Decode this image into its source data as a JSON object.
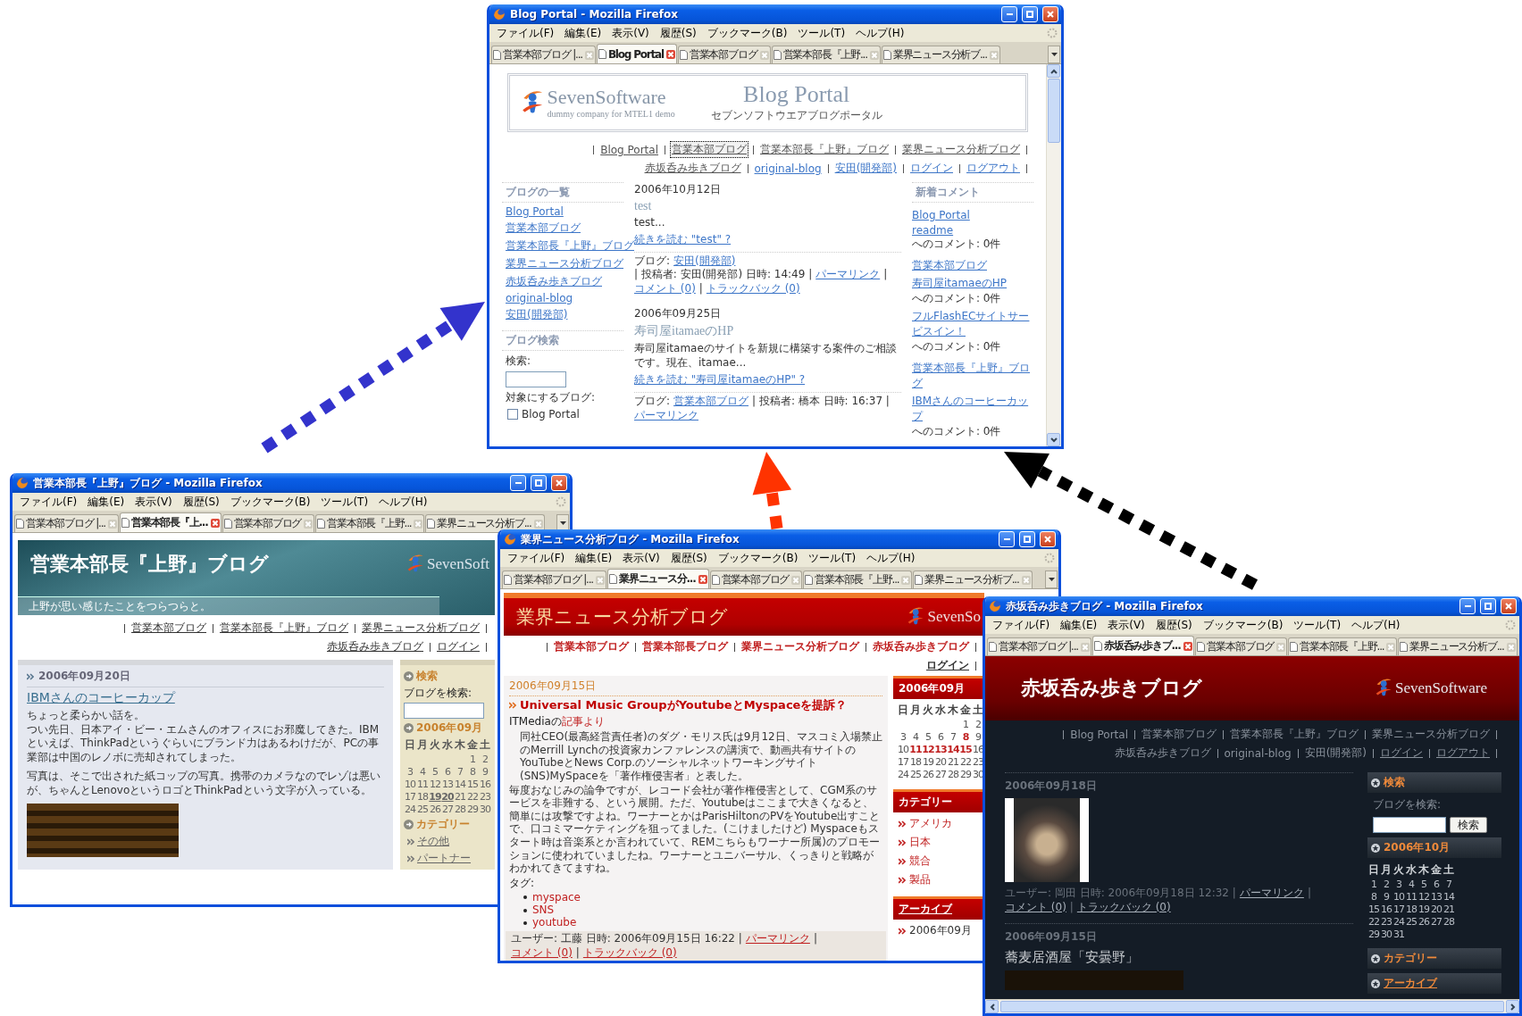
{
  "windows": [
    {
      "kind": "portal",
      "title": "Blog Portal - Mozilla Firefox",
      "menu": [
        "ファイル(F)",
        "編集(E)",
        "表示(V)",
        "履歴(S)",
        "ブックマーク(B)",
        "ツール(T)",
        "ヘルプ(H)"
      ],
      "tabs": [
        {
          "label": "営業本部ブログ |...",
          "selected": false
        },
        {
          "label": "Blog Portal",
          "selected": true
        },
        {
          "label": "営業本部ブログ",
          "selected": false
        },
        {
          "label": "営業本部長『上野...",
          "selected": false
        },
        {
          "label": "業界ニュース分析ブ...",
          "selected": false
        }
      ],
      "page": {
        "logo": {
          "name": "SevenSoftware",
          "tagline": "dummy company for MTEL1 demo"
        },
        "title": "Blog Portal",
        "subtitle": "セブンソフトウエアブログポータル",
        "nav": [
          {
            "label": "Blog Portal",
            "selected": false
          },
          {
            "label": "営業本部ブログ",
            "selected": true
          },
          {
            "label": "営業本部長『上野』ブログ",
            "selected": false
          },
          {
            "label": "業界ニュース分析ブログ",
            "selected": false
          },
          {
            "label": "赤坂呑み歩きブログ",
            "selected": false
          },
          {
            "label": "original-blog",
            "selected": false
          },
          {
            "label": "安田(開発部)",
            "selected": false
          },
          {
            "label": "ログイン",
            "selected": false
          },
          {
            "label": "ログアウト",
            "selected": false
          }
        ],
        "blog_list": {
          "heading": "ブログの一覧",
          "items": [
            "Blog Portal",
            "営業本部ブログ",
            "営業本部長『上野』ブログ",
            "業界ニュース分析ブログ",
            "赤坂呑み歩きブログ",
            "original-blog",
            "安田(開発部)"
          ]
        },
        "search": {
          "heading": "ブログ検索",
          "label": "検索:",
          "targets_label": "対象にするブログ:",
          "targets": [
            {
              "label": "Blog Portal",
              "checked": false
            }
          ]
        },
        "posts": [
          {
            "date": "2006年10月12日",
            "title": "test",
            "excerpt": "test...",
            "more": "続きを読む \"test\" ?",
            "meta": [
              {
                "text": "ブログ: ",
                "link": false
              },
              {
                "text": "安田(開発部)",
                "link": true
              },
              {
                "text": " | 投稿者: 安田(開発部) 日時: 14:49 | ",
                "link": false
              },
              {
                "text": "パーマリンク",
                "link": true
              },
              {
                "text": " | ",
                "link": false
              },
              {
                "text": "コメント (0)",
                "link": true
              },
              {
                "text": " | ",
                "link": false
              },
              {
                "text": "トラックバック (0)",
                "link": true
              }
            ]
          },
          {
            "date": "2006年09月25日",
            "title": "寿司屋itamaeのHP",
            "excerpt": "寿司屋itamaeのサイトを新規に構築する案件のご相談です。現在、itamae...",
            "more": "続きを読む \"寿司屋itamaeのHP\" ?",
            "meta": [
              {
                "text": "ブログ: ",
                "link": false
              },
              {
                "text": "営業本部ブログ",
                "link": true
              },
              {
                "text": " | 投稿者: 橋本 日時: 16:37 | ",
                "link": false
              },
              {
                "text": "パーマリンク",
                "link": true
              }
            ]
          }
        ],
        "recent": {
          "heading": "新着コメント",
          "items": [
            {
              "kind": "blog",
              "link": "Blog Portal"
            },
            {
              "kind": "comment",
              "link": "readme",
              "suffix": "へのコメント: 0件"
            },
            {
              "kind": "blog",
              "link": "営業本部ブログ"
            },
            {
              "kind": "comment",
              "link": "寿司屋itamaeのHP",
              "suffix": "へのコメント: 0件"
            },
            {
              "kind": "comment",
              "link": "フルFlashECサイトサービスイン！",
              "suffix": "へのコメント: 0件"
            },
            {
              "kind": "blog",
              "link": "営業本部長『上野』ブログ"
            },
            {
              "kind": "comment",
              "link": "IBMさんのコーヒーカップ",
              "suffix": "へのコメント: 0件"
            }
          ]
        }
      }
    },
    {
      "kind": "teal",
      "title": "営業本部長『上野』ブログ - Mozilla Firefox",
      "menu": [
        "ファイル(F)",
        "編集(E)",
        "表示(V)",
        "履歴(S)",
        "ブックマーク(B)",
        "ツール(T)",
        "ヘルプ(H)"
      ],
      "tabs": [
        {
          "label": "営業本部ブログ |...",
          "selected": false
        },
        {
          "label": "営業本部長『上...",
          "selected": true
        },
        {
          "label": "営業本部ブログ",
          "selected": false
        },
        {
          "label": "営業本部長『上野...",
          "selected": false
        },
        {
          "label": "業界ニュース分析ブ...",
          "selected": false
        }
      ],
      "page": {
        "title": "営業本部長『上野』ブログ",
        "logo": {
          "name": "SevenSoft"
        },
        "tagline": "上野が思い感じたことをつらつらと。",
        "nav": [
          "営業本部ブログ",
          "営業本部長『上野』ブログ",
          "業界ニュース分析ブログ",
          "赤坂呑み歩きブログ",
          "ログイン"
        ],
        "post": {
          "date": "2006年09月20日",
          "title": "IBMさんのコーヒーカップ",
          "paragraphs": [
            [
              "ちょっと柔らかい話を。",
              "つい先日、日本アイ・ビー・エムさんのオフィスにお邪魔してきた。IBMといえば、ThinkPadというぐらいにブランド力はあるわけだが、PCの事業部は中国のレノボに売却されてしまった。"
            ],
            [
              "写真は、そこで出された紙コップの写真。携帯のカメラなのでレゾは悪いが、ちゃんとLenovoというロゴとThinkPadという文字が入っている。"
            ]
          ]
        },
        "sidebar": {
          "search_heading": "検索",
          "search_label": "ブログを検索:",
          "calendar": {
            "heading": "2006年09月",
            "weekdays": [
              "日",
              "月",
              "火",
              "水",
              "木",
              "金",
              "土"
            ],
            "weeks": [
              {
                "kind": "end_aligned",
                "days": [
                  {
                    "day": "1",
                    "linked": false
                  },
                  {
                    "day": "2",
                    "linked": false
                  }
                ]
              },
              {
                "kind": "start_aligned",
                "days": [
                  {
                    "day": "3",
                    "linked": false
                  },
                  {
                    "day": "4",
                    "linked": false
                  },
                  {
                    "day": "5",
                    "linked": false
                  },
                  {
                    "day": "6",
                    "linked": false
                  },
                  {
                    "day": "7",
                    "linked": false
                  },
                  {
                    "day": "8",
                    "linked": false
                  },
                  {
                    "day": "9",
                    "linked": false
                  }
                ]
              },
              {
                "kind": "start_aligned",
                "days": [
                  {
                    "day": "10",
                    "linked": false
                  },
                  {
                    "day": "11",
                    "linked": false
                  },
                  {
                    "day": "12",
                    "linked": false
                  },
                  {
                    "day": "13",
                    "linked": false
                  },
                  {
                    "day": "14",
                    "linked": false
                  },
                  {
                    "day": "15",
                    "linked": false
                  },
                  {
                    "day": "16",
                    "linked": false
                  }
                ]
              },
              {
                "kind": "start_aligned",
                "days": [
                  {
                    "day": "17",
                    "linked": false
                  },
                  {
                    "day": "18",
                    "linked": false
                  },
                  {
                    "day": "19",
                    "linked": true
                  },
                  {
                    "day": "20",
                    "linked": true
                  },
                  {
                    "day": "21",
                    "linked": false
                  },
                  {
                    "day": "22",
                    "linked": false
                  },
                  {
                    "day": "23",
                    "linked": false
                  }
                ]
              },
              {
                "kind": "start_aligned",
                "days": [
                  {
                    "day": "24",
                    "linked": false
                  },
                  {
                    "day": "25",
                    "linked": false
                  },
                  {
                    "day": "26",
                    "linked": false
                  },
                  {
                    "day": "27",
                    "linked": false
                  },
                  {
                    "day": "28",
                    "linked": false
                  },
                  {
                    "day": "29",
                    "linked": false
                  },
                  {
                    "day": "30",
                    "linked": false
                  }
                ]
              }
            ]
          },
          "category_heading": "カテゴリー",
          "categories": [
            "その他",
            "パートナー"
          ]
        }
      }
    },
    {
      "kind": "red",
      "title": "業界ニュース分析ブログ - Mozilla Firefox",
      "menu": [
        "ファイル(F)",
        "編集(E)",
        "表示(V)",
        "履歴(S)",
        "ブックマーク(B)",
        "ツール(T)",
        "ヘルプ(H)"
      ],
      "tabs": [
        {
          "label": "営業本部ブログ |...",
          "selected": false
        },
        {
          "label": "業界ニュース分...",
          "selected": true
        },
        {
          "label": "営業本部ブログ",
          "selected": false
        },
        {
          "label": "営業本部長『上野...",
          "selected": false
        },
        {
          "label": "業界ニュース分析ブ...",
          "selected": false
        }
      ],
      "page": {
        "title": "業界ニュース分析ブログ",
        "logo": {
          "name": "SevenSo"
        },
        "nav": [
          "営業本部ブログ",
          "営業本部長ブログ",
          "業界ニュース分析ブログ",
          "赤坂呑み歩きブログ",
          "ログイン"
        ],
        "post": {
          "date": "2006年09月15日",
          "title": "Universal Music GroupがYoutubeとMyspaceを提訴？",
          "source_text": "ITMediaの",
          "source_link": "記事より",
          "quote": "同社CEO(最高経営責任者)のダグ・モリス氏は9月12日、マスコミ入場禁止のMerrill Lynchの投資家カンファレンスの講演で、動画共有サイトのYouTubeとNews Corp.のソーシャルネットワーキングサイト(SNS)MySpaceを「著作権侵害者」と表した。",
          "body": "毎度おなじみの論争ですが、レコード会社が著作権侵害として、CGM系のサービスを非難する、という展開。ただ、Youtubeはここまで大きくなると、簡単には攻撃ですよね。ワーナーとかはParisHiltonのPVをYoutube出すことで、口コミマーケティングを狙ってました。(こけましたけど) Myspaceもスタート時は音楽系とか言われていて、REMこちらもワーナー所属)のプロモーションに使われていましたね。ワーナーとユニバーサル、くっきりと戦略がわかれてきてますね。",
          "tags_label": "タグ:",
          "tags": [
            "myspace",
            "SNS",
            "youtube"
          ],
          "meta": [
            {
              "text": "ユーザー: 工藤 日時: 2006年09月15日 16:22 | ",
              "link": false
            },
            {
              "text": "パーマリンク",
              "link": true
            },
            {
              "text": " | ",
              "link": false
            },
            {
              "text": "コメント (0)",
              "link": true
            },
            {
              "text": " | ",
              "link": false
            },
            {
              "text": "トラックバック (0)",
              "link": true
            }
          ]
        },
        "sidebar": {
          "calendar": {
            "heading": "2006年09月",
            "weekdays": [
              "日",
              "月",
              "火",
              "水",
              "木",
              "金",
              "土"
            ],
            "weeks": [
              {
                "kind": "end_aligned",
                "days": [
                  {
                    "day": "1",
                    "linked": false
                  },
                  {
                    "day": "2",
                    "linked": false
                  }
                ]
              },
              {
                "kind": "start_aligned",
                "days": [
                  {
                    "day": "3",
                    "linked": false
                  },
                  {
                    "day": "4",
                    "linked": false
                  },
                  {
                    "day": "5",
                    "linked": false
                  },
                  {
                    "day": "6",
                    "linked": false
                  },
                  {
                    "day": "7",
                    "linked": false
                  },
                  {
                    "day": "8",
                    "linked": true
                  },
                  {
                    "day": "9",
                    "linked": false
                  }
                ]
              },
              {
                "kind": "start_aligned",
                "days": [
                  {
                    "day": "10",
                    "linked": false
                  },
                  {
                    "day": "11",
                    "linked": true
                  },
                  {
                    "day": "12",
                    "linked": true
                  },
                  {
                    "day": "13",
                    "linked": true
                  },
                  {
                    "day": "14",
                    "linked": true
                  },
                  {
                    "day": "15",
                    "linked": true
                  },
                  {
                    "day": "16",
                    "linked": false
                  }
                ]
              },
              {
                "kind": "start_aligned",
                "days": [
                  {
                    "day": "17",
                    "linked": false
                  },
                  {
                    "day": "18",
                    "linked": false
                  },
                  {
                    "day": "19",
                    "linked": false
                  },
                  {
                    "day": "20",
                    "linked": false
                  },
                  {
                    "day": "21",
                    "linked": false
                  },
                  {
                    "day": "22",
                    "linked": false
                  },
                  {
                    "day": "23",
                    "linked": false
                  }
                ]
              },
              {
                "kind": "start_aligned",
                "days": [
                  {
                    "day": "24",
                    "linked": false
                  },
                  {
                    "day": "25",
                    "linked": false
                  },
                  {
                    "day": "26",
                    "linked": false
                  },
                  {
                    "day": "27",
                    "linked": false
                  },
                  {
                    "day": "28",
                    "linked": false
                  },
                  {
                    "day": "29",
                    "linked": false
                  },
                  {
                    "day": "30",
                    "linked": false
                  }
                ]
              }
            ]
          },
          "category_heading": "カテゴリー",
          "categories": [
            "アメリカ",
            "日本",
            "競合",
            "製品"
          ],
          "archive_heading": "アーカイブ",
          "archives": [
            "2006年09月"
          ]
        }
      }
    },
    {
      "kind": "dark",
      "title": "赤坂呑み歩きブログ - Mozilla Firefox",
      "menu": [
        "ファイル(F)",
        "編集(E)",
        "表示(V)",
        "履歴(S)",
        "ブックマーク(B)",
        "ツール(T)",
        "ヘルプ(H)"
      ],
      "tabs": [
        {
          "label": "営業本部ブログ |...",
          "selected": false
        },
        {
          "label": "赤坂呑み歩きブ...",
          "selected": true
        },
        {
          "label": "営業本部ブログ",
          "selected": false
        },
        {
          "label": "営業本部長『上野...",
          "selected": false
        },
        {
          "label": "業界ニュース分析ブ...",
          "selected": false
        }
      ],
      "page": {
        "title": "赤坂呑み歩きブログ",
        "logo": {
          "name": "SevenSoftware"
        },
        "nav": [
          "Blog Portal",
          "営業本部ブログ",
          "営業本部長『上野』ブログ",
          "業界ニュース分析ブログ",
          "赤坂呑み歩きブログ",
          "original-blog",
          "安田(開発部)",
          "ログイン",
          "ログアウト"
        ],
        "posts": [
          {
            "kind": "photo",
            "date": "2006年09月18日",
            "meta": [
              {
                "text": "ユーザー: 岡田 日時: 2006年09月18日 12:32 | ",
                "link": false
              },
              {
                "text": "パーマリンク",
                "link": true
              },
              {
                "text": " | ",
                "link": false
              },
              {
                "text": "コメント (0)",
                "link": true
              },
              {
                "text": " | ",
                "link": false
              },
              {
                "text": "トラックバック (0)",
                "link": true
              }
            ]
          },
          {
            "kind": "titled",
            "date": "2006年09月15日",
            "title": "蕎麦居酒屋「安曇野」"
          }
        ],
        "sidebar": {
          "search_heading": "検索",
          "search_label": "ブログを検索:",
          "search_button": "検索",
          "calendar": {
            "heading": "2006年10月",
            "weekdays": [
              "日",
              "月",
              "火",
              "水",
              "木",
              "金",
              "土"
            ],
            "weeks": [
              {
                "kind": "start_aligned",
                "days": [
                  {
                    "day": "1",
                    "linked": false
                  },
                  {
                    "day": "2",
                    "linked": false
                  },
                  {
                    "day": "3",
                    "linked": false
                  },
                  {
                    "day": "4",
                    "linked": false
                  },
                  {
                    "day": "5",
                    "linked": false
                  },
                  {
                    "day": "6",
                    "linked": false
                  },
                  {
                    "day": "7",
                    "linked": false
                  }
                ]
              },
              {
                "kind": "start_aligned",
                "days": [
                  {
                    "day": "8",
                    "linked": false
                  },
                  {
                    "day": "9",
                    "linked": false
                  },
                  {
                    "day": "10",
                    "linked": false
                  },
                  {
                    "day": "11",
                    "linked": false
                  },
                  {
                    "day": "12",
                    "linked": false
                  },
                  {
                    "day": "13",
                    "linked": false
                  },
                  {
                    "day": "14",
                    "linked": false
                  }
                ]
              },
              {
                "kind": "start_aligned",
                "days": [
                  {
                    "day": "15",
                    "linked": false
                  },
                  {
                    "day": "16",
                    "linked": false
                  },
                  {
                    "day": "17",
                    "linked": false
                  },
                  {
                    "day": "18",
                    "linked": false
                  },
                  {
                    "day": "19",
                    "linked": false
                  },
                  {
                    "day": "20",
                    "linked": false
                  },
                  {
                    "day": "21",
                    "linked": false
                  }
                ]
              },
              {
                "kind": "start_aligned",
                "days": [
                  {
                    "day": "22",
                    "linked": false
                  },
                  {
                    "day": "23",
                    "linked": false
                  },
                  {
                    "day": "24",
                    "linked": false
                  },
                  {
                    "day": "25",
                    "linked": false
                  },
                  {
                    "day": "26",
                    "linked": false
                  },
                  {
                    "day": "27",
                    "linked": false
                  },
                  {
                    "day": "28",
                    "linked": false
                  }
                ]
              },
              {
                "kind": "start_aligned",
                "days": [
                  {
                    "day": "29",
                    "linked": false
                  },
                  {
                    "day": "30",
                    "linked": false
                  },
                  {
                    "day": "31",
                    "linked": false
                  }
                ]
              }
            ]
          },
          "category_heading": "カテゴリー",
          "archive_heading": "アーカイブ"
        }
      }
    }
  ]
}
